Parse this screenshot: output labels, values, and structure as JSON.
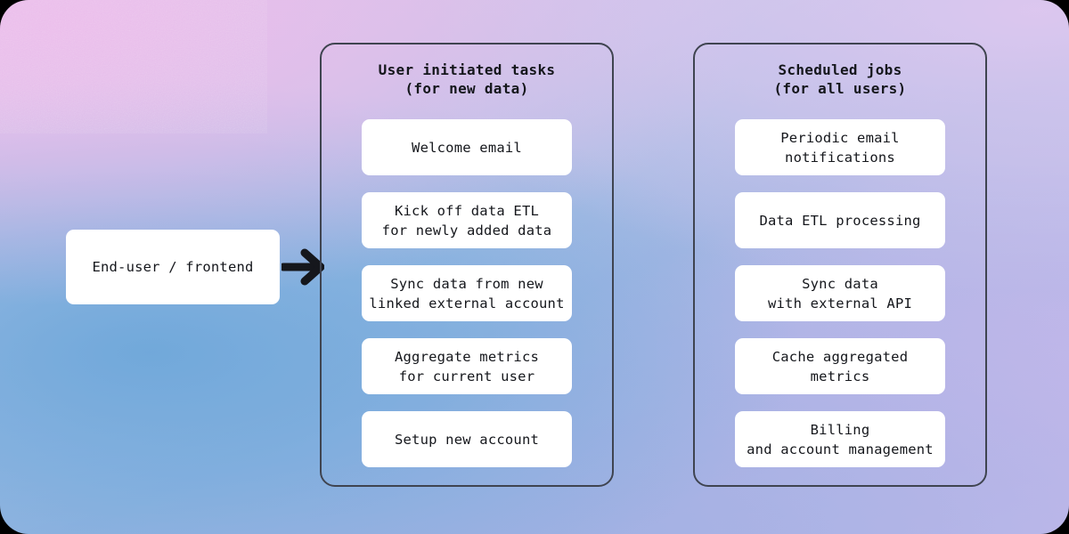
{
  "diagram": {
    "source_node": {
      "label": "End-user / frontend"
    },
    "arrow": {
      "name": "right-arrow-icon",
      "color": "#15171c"
    },
    "groups": [
      {
        "id": "user-initiated-tasks",
        "title": "User initiated tasks\n(for new data)",
        "cards": [
          {
            "label": "Welcome email"
          },
          {
            "label": "Kick off data ETL\nfor newly added data"
          },
          {
            "label": "Sync data from new\nlinked external account"
          },
          {
            "label": "Aggregate metrics\nfor current user"
          },
          {
            "label": "Setup new account"
          }
        ]
      },
      {
        "id": "scheduled-jobs",
        "title": "Scheduled jobs\n(for all users)",
        "cards": [
          {
            "label": "Periodic email\nnotifications"
          },
          {
            "label": "Data ETL processing"
          },
          {
            "label": "Sync data\nwith external API"
          },
          {
            "label": "Cache aggregated\nmetrics"
          },
          {
            "label": "Billing\nand account management"
          }
        ]
      }
    ],
    "colors": {
      "card_background": "#ffffff",
      "text": "#15171c",
      "group_border": "#3f4450",
      "gradient_pink": "#e3c7ec",
      "gradient_blue": "#79b0dd",
      "gradient_purple": "#c9bdee"
    }
  }
}
